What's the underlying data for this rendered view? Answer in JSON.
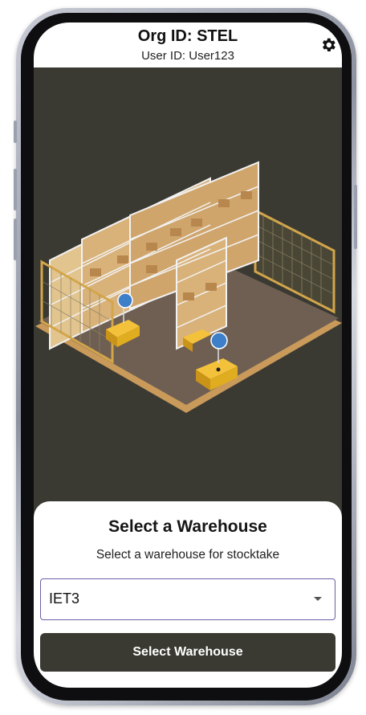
{
  "header": {
    "org_id": "Org ID: STEL",
    "user_id": "User ID: User123",
    "settings_icon": "gear-icon"
  },
  "colors": {
    "background": "#3a3a33",
    "accent_border": "#6b5fa8",
    "robot_yellow": "#f0b21c",
    "shelf_wood": "#d9b27a"
  },
  "card": {
    "title": "Select a Warehouse",
    "subtitle": "Select a warehouse for stocktake",
    "selected_warehouse": "IET3",
    "dropdown_icon": "caret-down-icon",
    "button_label": "Select Warehouse"
  }
}
